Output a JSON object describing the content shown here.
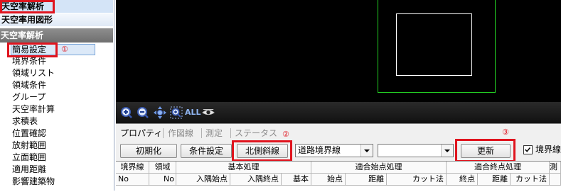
{
  "left_panel": {
    "top_item_1": "天空率解析",
    "top_item_2": "天空率用図形",
    "section_header": "天空率解析",
    "items": [
      "簡易設定",
      "境界条件",
      "領域リスト",
      "領域条件",
      "グループ",
      "天空率計算",
      "求積表",
      "位置確認",
      "放射範囲",
      "立面範囲",
      "適用距離",
      "影響建築物"
    ],
    "annotation": "①"
  },
  "toolbar": {
    "icons": [
      "zoom-in-icon",
      "zoom-out-icon",
      "pan-icon",
      "zoom-window-icon",
      "zoom-all-icon",
      "eye-icon"
    ],
    "all_label": "ALL"
  },
  "tabs": [
    {
      "label": "プロパティ",
      "active": true
    },
    {
      "label": "作図線",
      "active": false
    },
    {
      "label": "測定",
      "active": false
    },
    {
      "label": "ステータス",
      "active": false
    }
  ],
  "actions": {
    "reset_label": "初期化",
    "condition_label": "条件設定",
    "north_slope_label": "北側斜線",
    "road_select_value": "道路境界線",
    "second_select_value": "",
    "update_label": "更新",
    "boundary_check_label": "境界線",
    "boundary_checked": true,
    "annotation_2": "②",
    "annotation_3": "③"
  },
  "grid": {
    "group_headers": [
      "境界線",
      "領域",
      "基本処理",
      "適合始点処理",
      "適合終点処理",
      "測"
    ],
    "sub_headers": [
      "No",
      "No",
      "入隅始点",
      "入隅終点",
      "基本",
      "始点",
      "距離",
      "カット法",
      "終点",
      "距離",
      "カット法"
    ]
  },
  "colors": {
    "highlight_red": "#e0141e",
    "viewport_bg": "#000000",
    "outer_rect": "#22cc22",
    "inner_rect": "#ffffff"
  }
}
